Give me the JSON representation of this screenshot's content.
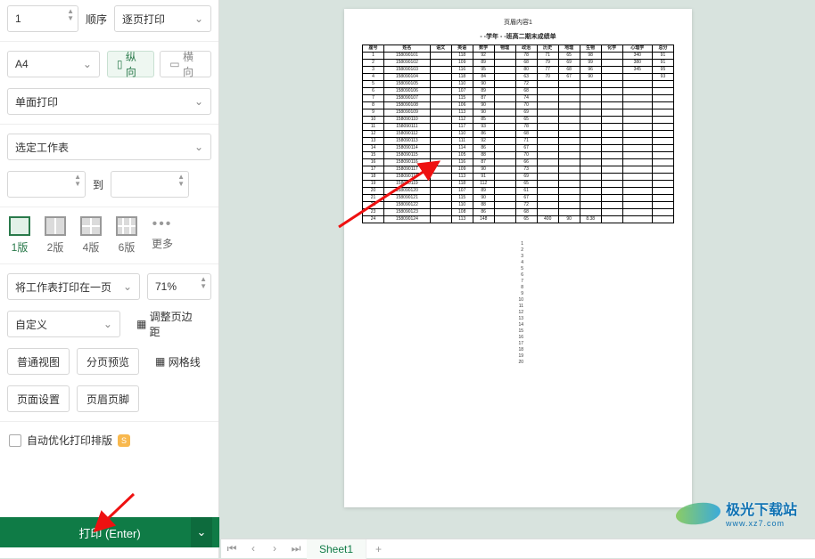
{
  "copies": {
    "value": "1",
    "order_label": "顺序",
    "collate_label": "逐页打印"
  },
  "paper": {
    "size": "A4",
    "portrait": "纵向",
    "landscape": "横向",
    "portrait_active": true
  },
  "duplex": "单面打印",
  "scope": "选定工作表",
  "range": {
    "to_label": "到",
    "from": "",
    "to": ""
  },
  "layout": {
    "opt1": "1版",
    "opt2": "2版",
    "opt4": "4版",
    "opt6": "6版",
    "more": "更多"
  },
  "fit": {
    "label": "将工作表打印在一页",
    "scale": "71%"
  },
  "custom": "自定义",
  "margins_label": "调整页边距",
  "view_normal": "普通视图",
  "view_pagebreak": "分页预览",
  "gridlines": "网格线",
  "page_setup": "页面设置",
  "header_footer": "页眉页脚",
  "auto_optimize": "自动优化打印排版",
  "print_button": "打印 (Enter)",
  "sheet_tab": "Sheet1",
  "preview": {
    "header": "页眉内容1",
    "title": "- -学年 - -班高二期末成绩单",
    "headers": [
      "座号",
      "姓名",
      "语文",
      "英语",
      "数学",
      "物理",
      "政治",
      "历史",
      "地理",
      "生物",
      "化学",
      "心理学",
      "总分"
    ],
    "rows": [
      [
        "1",
        "158090101",
        "",
        "118",
        "92",
        "",
        "78",
        "71",
        "65",
        "98",
        "",
        "340",
        "91"
      ],
      [
        "2",
        "158090102",
        "",
        "109",
        "89",
        "",
        "68",
        "79",
        "69",
        "99",
        "",
        "380",
        "91"
      ],
      [
        "3",
        "158090103",
        "",
        "116",
        "95",
        "",
        "80",
        "77",
        "68",
        "96",
        "",
        "345",
        "95"
      ],
      [
        "4",
        "158090104",
        "",
        "118",
        "84",
        "",
        "63",
        "70",
        "67",
        "90",
        "",
        "",
        "93"
      ],
      [
        "5",
        "158090105",
        "",
        "110",
        "90",
        "",
        "72",
        "",
        "",
        "",
        "",
        "",
        ""
      ],
      [
        "6",
        "158090106",
        "",
        "107",
        "89",
        "",
        "68",
        "",
        "",
        "",
        "",
        "",
        ""
      ],
      [
        "7",
        "158090107",
        "",
        "115",
        "87",
        "",
        "74",
        "",
        "",
        "",
        "",
        "",
        ""
      ],
      [
        "8",
        "158090108",
        "",
        "106",
        "90",
        "",
        "70",
        "",
        "",
        "",
        "",
        "",
        ""
      ],
      [
        "9",
        "158090109",
        "",
        "113",
        "90",
        "",
        "69",
        "",
        "",
        "",
        "",
        "",
        ""
      ],
      [
        "10",
        "158090110",
        "",
        "112",
        "85",
        "",
        "65",
        "",
        "",
        "",
        "",
        "",
        ""
      ],
      [
        "11",
        "158090111",
        "",
        "117",
        "93",
        "",
        "78",
        "",
        "",
        "",
        "",
        "",
        ""
      ],
      [
        "12",
        "158090112",
        "",
        "110",
        "86",
        "",
        "68",
        "",
        "",
        "",
        "",
        "",
        ""
      ],
      [
        "13",
        "158090113",
        "",
        "111",
        "92",
        "",
        "71",
        "",
        "",
        "",
        "",
        "",
        ""
      ],
      [
        "14",
        "158090114",
        "",
        "114",
        "86",
        "",
        "67",
        "",
        "",
        "",
        "",
        "",
        ""
      ],
      [
        "15",
        "158090115",
        "",
        "105",
        "88",
        "",
        "70",
        "",
        "",
        "",
        "",
        "",
        ""
      ],
      [
        "16",
        "158090116",
        "",
        "116",
        "87",
        "",
        "66",
        "",
        "",
        "",
        "",
        "",
        ""
      ],
      [
        "17",
        "158090117",
        "",
        "109",
        "90",
        "",
        "73",
        "",
        "",
        "",
        "",
        "",
        ""
      ],
      [
        "18",
        "158090118",
        "",
        "113",
        "91",
        "",
        "69",
        "",
        "",
        "",
        "",
        "",
        ""
      ],
      [
        "19",
        "158090119",
        "",
        "118",
        "112",
        "",
        "65",
        "",
        "",
        "",
        "",
        "",
        ""
      ],
      [
        "20",
        "158090120",
        "",
        "107",
        "89",
        "",
        "61",
        "",
        "",
        "",
        "",
        "",
        ""
      ],
      [
        "21",
        "158090121",
        "",
        "115",
        "90",
        "",
        "67",
        "",
        "",
        "",
        "",
        "",
        ""
      ],
      [
        "22",
        "158090122",
        "",
        "110",
        "88",
        "",
        "72",
        "",
        "",
        "",
        "",
        "",
        ""
      ],
      [
        "23",
        "158090123",
        "",
        "108",
        "86",
        "",
        "68",
        "",
        "",
        "",
        "",
        "",
        ""
      ],
      [
        "24",
        "158090124",
        "",
        "113",
        "148",
        "",
        "65",
        "400",
        "90",
        "8.38",
        "",
        "",
        ""
      ]
    ],
    "below_numbers": [
      "1",
      "2",
      "3",
      "4",
      "5",
      "6",
      "7",
      "8",
      "9",
      "10",
      "11",
      "12",
      "13",
      "14",
      "15",
      "16",
      "17",
      "18",
      "19",
      "20"
    ]
  },
  "watermark": {
    "main": "极光下载站",
    "sub": "www.xz7.com"
  }
}
